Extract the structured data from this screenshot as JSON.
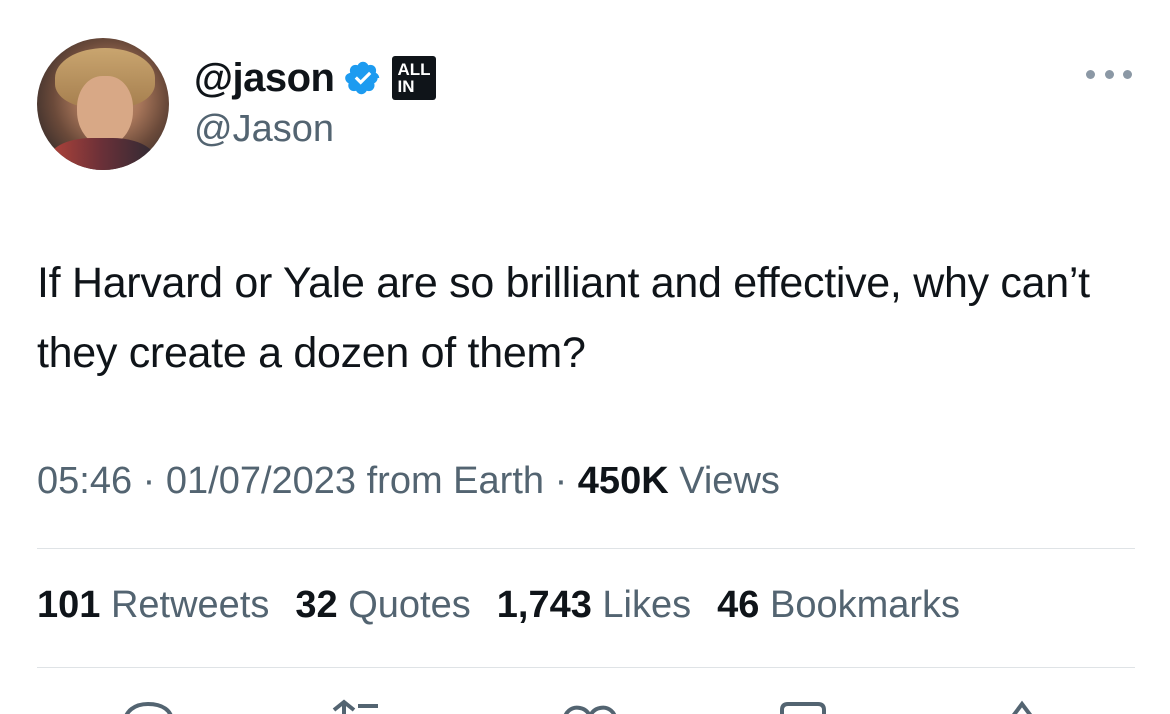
{
  "author": {
    "display_name": "@jason",
    "handle": "@Jason",
    "affiliate_badge": [
      "ALL",
      "IN"
    ]
  },
  "tweet": {
    "text": "If Harvard or Yale are so brilliant and effective, why can’t they create a dozen of them?",
    "time": "05:46",
    "date": "01/07/2023",
    "source": "from Earth",
    "separator": "·",
    "views_count": "450K",
    "views_label": "Views"
  },
  "stats": {
    "retweets_count": "101",
    "retweets_label": "Retweets",
    "quotes_count": "32",
    "quotes_label": "Quotes",
    "likes_count": "1,743",
    "likes_label": "Likes",
    "bookmarks_count": "46",
    "bookmarks_label": "Bookmarks"
  },
  "icons": {
    "verified": "verified-badge-icon",
    "more": "more-options-icon",
    "actions": [
      "reply-icon",
      "retweet-icon",
      "like-icon",
      "bookmark-icon",
      "share-icon"
    ]
  },
  "colors": {
    "verified_blue": "#1d9bf0",
    "text_primary": "#0f1419",
    "text_secondary": "#536471",
    "divider": "#dfe3e6"
  }
}
